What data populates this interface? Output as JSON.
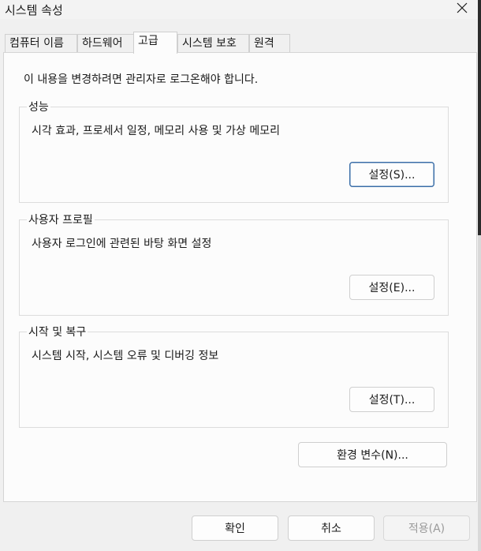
{
  "window": {
    "title": "시스템 속성",
    "close_glyph": "✕"
  },
  "tabs": [
    {
      "label": "컴퓨터 이름"
    },
    {
      "label": "하드웨어"
    },
    {
      "label": "고급",
      "active": true
    },
    {
      "label": "시스템 보호"
    },
    {
      "label": "원격"
    }
  ],
  "info_text": "이 내용을 변경하려면 관리자로 로그온해야 합니다.",
  "groups": [
    {
      "title": "성능",
      "description": "시각 효과, 프로세서 일정, 메모리 사용 및 가상 메모리",
      "button": "설정(S)..."
    },
    {
      "title": "사용자 프로필",
      "description": "사용자 로그인에 관련된 바탕 화면 설정",
      "button": "설정(E)..."
    },
    {
      "title": "시작 및 복구",
      "description": "시스템 시작, 시스템 오류 및 디버깅 정보",
      "button": "설정(T)..."
    }
  ],
  "env_button": "환경 변수(N)...",
  "footer": {
    "ok": "확인",
    "cancel": "취소",
    "apply": "적용(A)"
  }
}
